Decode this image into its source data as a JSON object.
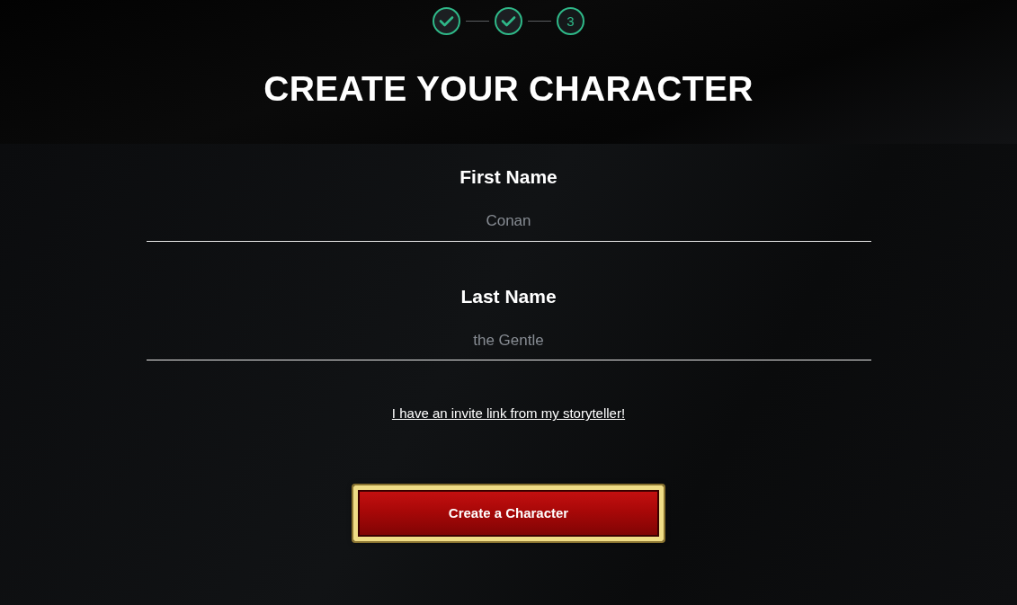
{
  "steps": [
    {
      "completed": true
    },
    {
      "completed": true
    },
    {
      "completed": false,
      "label": "3"
    }
  ],
  "title": "CREATE YOUR CHARACTER",
  "fields": [
    {
      "label": "First Name",
      "placeholder": "Conan"
    },
    {
      "label": "Last Name",
      "placeholder": "the Gentle"
    }
  ],
  "invite_link": "I have an invite link from my storyteller!",
  "submit_button": "Create a Character"
}
